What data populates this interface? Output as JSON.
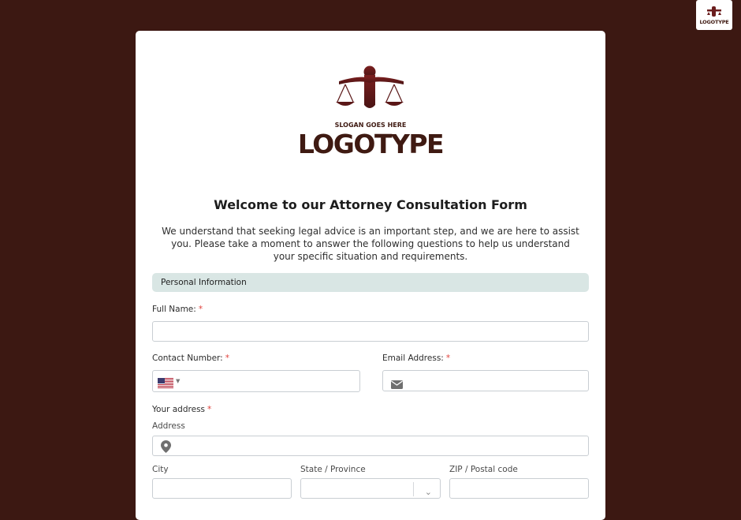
{
  "corner_logo": {
    "text": "LOGOTYPE"
  },
  "brand": {
    "slogan": "SLOGAN GOES HERE",
    "logotype": "LOGOTYPE"
  },
  "form": {
    "title": "Welcome to our Attorney Consultation Form",
    "intro": "We understand that seeking legal advice is an important step, and we are here to assist you. Please take a moment to answer the following questions to help us understand your specific situation and requirements.",
    "section": "Personal Information",
    "full_name_label": "Full Name:",
    "contact_label": "Contact Number:",
    "email_label": "Email Address:",
    "address_label": "Your address",
    "address_sublabel": "Address",
    "city_sublabel": "City",
    "state_sublabel": "State / Province",
    "zip_sublabel": "ZIP / Postal code",
    "required_mark": "*"
  },
  "colors": {
    "background": "#3c1812",
    "brand": "#3f1a12",
    "section_bar": "#d9e6e4",
    "required": "#e0413b"
  },
  "icons": {
    "flag": "us-flag-icon",
    "email": "envelope-icon",
    "address": "map-pin-icon",
    "select": "chevron-down-icon"
  }
}
